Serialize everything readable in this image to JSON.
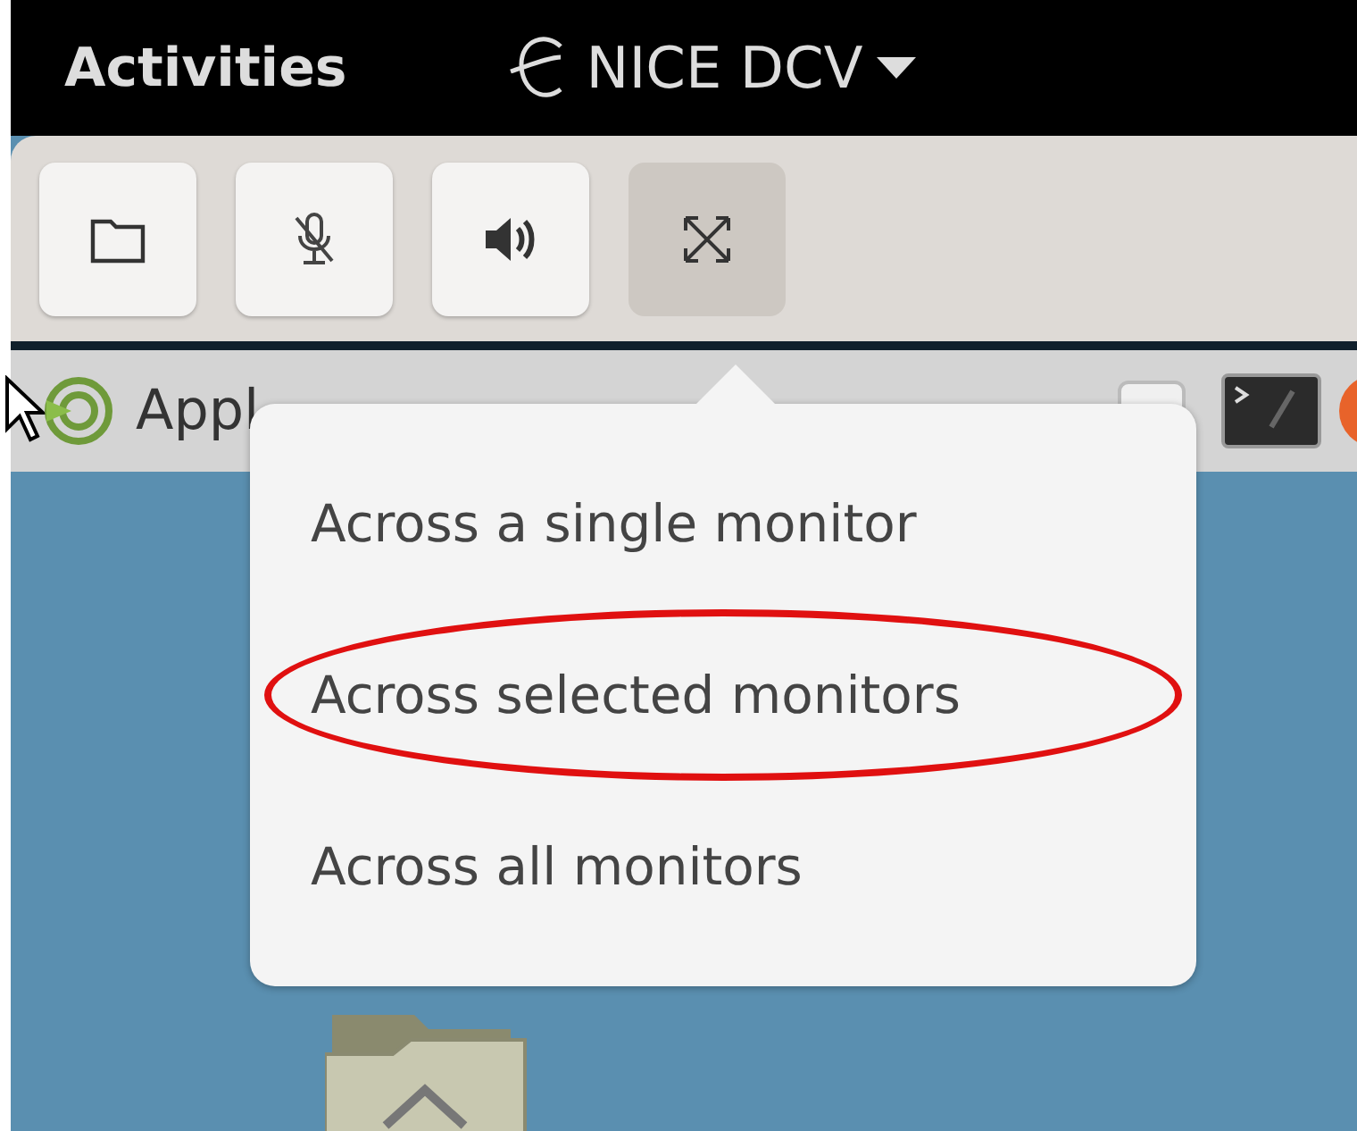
{
  "top_bar": {
    "activities": "Activities",
    "app_menu": "NICE DCV"
  },
  "toolbar": {
    "buttons": [
      {
        "kind": "folder",
        "selected": false
      },
      {
        "kind": "mic-off",
        "selected": false
      },
      {
        "kind": "speaker",
        "selected": false
      },
      {
        "kind": "fullscreen",
        "selected": true
      }
    ]
  },
  "panel": {
    "menu_label": "Appl"
  },
  "popover": {
    "items": [
      {
        "label": "Across a single monitor",
        "circled": false
      },
      {
        "label": "Across selected monitors",
        "circled": true
      },
      {
        "label": "Across all monitors",
        "circled": false
      }
    ]
  }
}
